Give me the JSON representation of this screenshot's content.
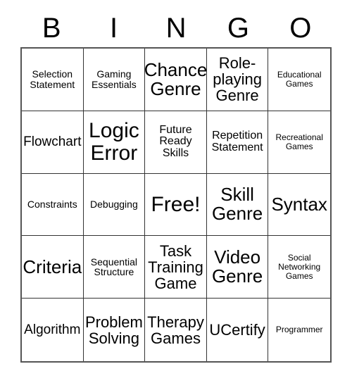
{
  "header": {
    "letters": [
      "B",
      "I",
      "N",
      "G",
      "O"
    ]
  },
  "grid": {
    "rows": 5,
    "columns": 5,
    "cells": [
      {
        "text": "Selection Statement",
        "size": "s"
      },
      {
        "text": "Gaming Essentials",
        "size": "s"
      },
      {
        "text": "Chance Genre",
        "size": "xxl"
      },
      {
        "text": "Role-playing Genre",
        "size": "xl"
      },
      {
        "text": "Educational Games",
        "size": "xs"
      },
      {
        "text": "Flowchart",
        "size": "l"
      },
      {
        "text": "Logic Error",
        "size": "huge"
      },
      {
        "text": "Future Ready Skills",
        "size": "m"
      },
      {
        "text": "Repetition Statement",
        "size": "m"
      },
      {
        "text": "Recreational Games",
        "size": "xs"
      },
      {
        "text": "Constraints",
        "size": "s"
      },
      {
        "text": "Debugging",
        "size": "s"
      },
      {
        "text": "Free!",
        "size": "huge"
      },
      {
        "text": "Skill Genre",
        "size": "xxl"
      },
      {
        "text": "Syntax",
        "size": "xxl"
      },
      {
        "text": "Criteria",
        "size": "xxl"
      },
      {
        "text": "Sequential Structure",
        "size": "s"
      },
      {
        "text": "Task Training Game",
        "size": "xl"
      },
      {
        "text": "Video Genre",
        "size": "xxl"
      },
      {
        "text": "Social Networking Games",
        "size": "xs"
      },
      {
        "text": "Algorithm",
        "size": "l"
      },
      {
        "text": "Problem Solving",
        "size": "xl"
      },
      {
        "text": "Therapy Games",
        "size": "xl"
      },
      {
        "text": "UCertify",
        "size": "xl"
      },
      {
        "text": "Programmer",
        "size": "xs"
      }
    ]
  },
  "colors": {
    "background": "#ffffff",
    "text": "#000000",
    "grid_line": "#333333",
    "grid_outer": "#555555"
  }
}
